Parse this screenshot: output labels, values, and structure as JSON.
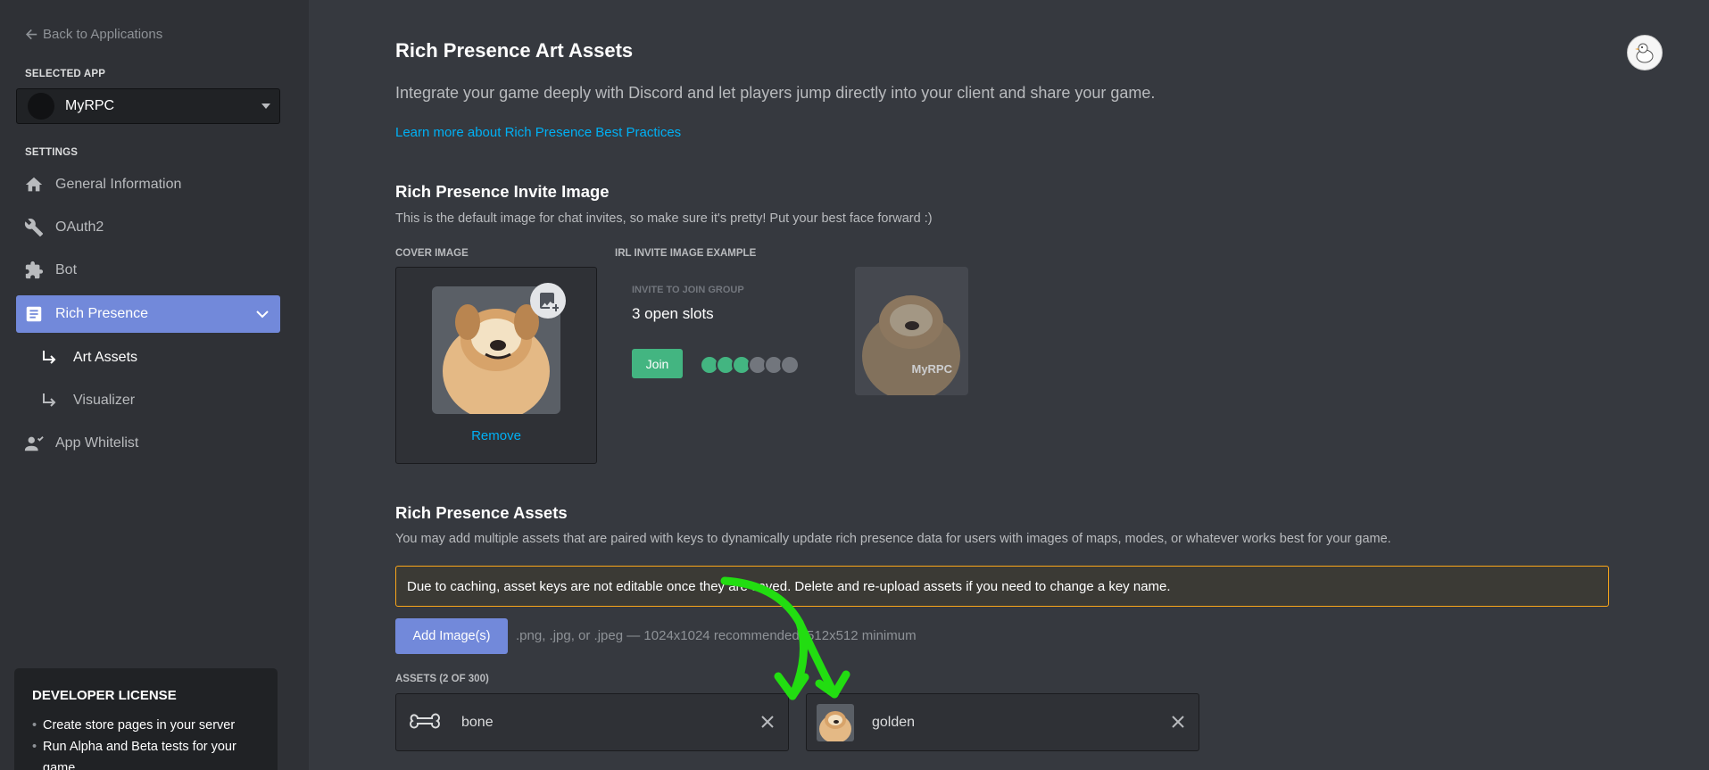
{
  "sidebar": {
    "back_label": "Back to Applications",
    "selected_app_label": "SELECTED APP",
    "app_name": "MyRPC",
    "settings_label": "SETTINGS",
    "nav": {
      "general": "General Information",
      "oauth2": "OAuth2",
      "bot": "Bot",
      "rich_presence": "Rich Presence",
      "art_assets": "Art Assets",
      "visualizer": "Visualizer",
      "app_whitelist": "App Whitelist"
    },
    "license": {
      "title": "DEVELOPER LICENSE",
      "items": [
        "Create store pages in your server",
        "Run Alpha and Beta tests for your game"
      ]
    }
  },
  "main": {
    "title": "Rich Presence Art Assets",
    "lead": "Integrate your game deeply with Discord and let players jump directly into your client and share your game.",
    "learn_more": "Learn more about Rich Presence Best Practices",
    "invite_section": {
      "title": "Rich Presence Invite Image",
      "desc": "This is the default image for chat invites, so make sure it's pretty! Put your best face forward :)",
      "cover_label": "COVER IMAGE",
      "example_label": "IRL INVITE IMAGE EXAMPLE",
      "remove": "Remove",
      "example": {
        "kicker": "INVITE TO JOIN GROUP",
        "slots": "3 open slots",
        "join": "Join",
        "app_name": "MyRPC"
      }
    },
    "assets_section": {
      "title": "Rich Presence Assets",
      "desc": "You may add multiple assets that are paired with keys to dynamically update rich presence data for users with images of maps, modes, or whatever works best for your game.",
      "warning": "Due to caching, asset keys are not editable once they are saved. Delete and re-upload assets if you need to change a key name.",
      "add_button": "Add Image(s)",
      "add_hint": ".png, .jpg, or .jpeg — 1024x1024 recommended, 512x512 minimum",
      "count_label": "ASSETS (2 OF 300)",
      "assets": [
        {
          "key": "bone",
          "icon": "bone-icon"
        },
        {
          "key": "golden",
          "icon": "dog-thumbnail"
        }
      ]
    }
  },
  "colors": {
    "accent": "#7289da",
    "link": "#00b0f4",
    "success": "#43b581",
    "warning_border": "#faa61a",
    "annotation": "#22dd11"
  }
}
